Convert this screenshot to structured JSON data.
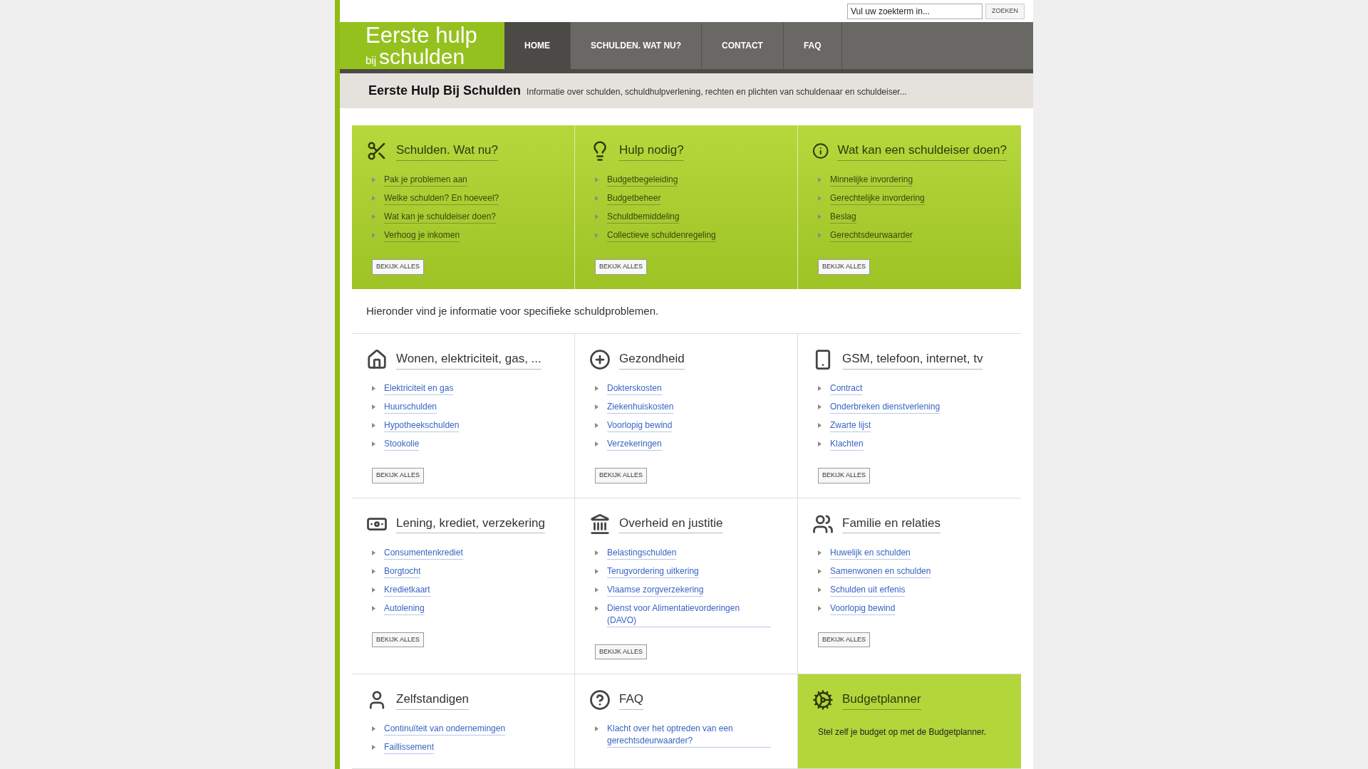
{
  "search": {
    "placeholder": "Vul uw zoekterm in...",
    "button": "ZOEKEN"
  },
  "logo": {
    "line1": "Eerste hulp",
    "small": "bij",
    "line2": "schulden"
  },
  "nav": [
    {
      "label": "HOME",
      "selected": true
    },
    {
      "label": "SCHULDEN. WAT NU?",
      "selected": false
    },
    {
      "label": "CONTACT",
      "selected": false
    },
    {
      "label": "FAQ",
      "selected": false
    }
  ],
  "tagline": {
    "title": "Eerste Hulp Bij Schulden",
    "text": "Informatie over schulden, schuldhulpverlening, rechten en plichten van schuldenaar en schuldeiser..."
  },
  "featured": [
    {
      "title": "Schulden. Wat nu?",
      "links": [
        "Pak je problemen aan",
        "Welke schulden? En hoeveel?",
        "Wat kan je schuldeiser doen?",
        "Verhoog je inkomen"
      ],
      "button": "BEKIJK ALLES"
    },
    {
      "title": "Hulp nodig?",
      "links": [
        "Budgetbegeleiding",
        "Budgetbeheer",
        "Schuldbemiddeling",
        "Collectieve schuldenregeling"
      ],
      "button": "BEKIJK ALLES"
    },
    {
      "title": "Wat kan een schuldeiser doen?",
      "links": [
        "Minnelijke invordering",
        "Gerechtelijke invordering",
        "Beslag",
        "Gerechtsdeurwaarder"
      ],
      "button": "BEKIJK ALLES"
    }
  ],
  "intro": "Hieronder vind je informatie voor specifieke schuldproblemen.",
  "categories": [
    {
      "kind": "links",
      "title": "Wonen, elektriciteit, gas, ...",
      "links": [
        "Elektriciteit en gas",
        "Huurschulden",
        "Hypotheekschulden",
        "Stookolie"
      ],
      "button": "BEKIJK ALLES"
    },
    {
      "kind": "links",
      "title": "Gezondheid",
      "links": [
        "Dokterskosten",
        "Ziekenhuiskosten",
        "Voorlopig bewind",
        "Verzekeringen"
      ],
      "button": "BEKIJK ALLES"
    },
    {
      "kind": "links",
      "title": "GSM, telefoon, internet, tv",
      "links": [
        "Contract",
        "Onderbreken dienstverlening",
        "Zwarte lijst",
        "Klachten"
      ],
      "button": "BEKIJK ALLES"
    },
    {
      "kind": "links",
      "title": "Lening, krediet, verzekering",
      "links": [
        "Consumentenkrediet",
        "Borgtocht",
        "Kredietkaart",
        "Autolening"
      ],
      "button": "BEKIJK ALLES"
    },
    {
      "kind": "links",
      "title": "Overheid en justitie",
      "links": [
        "Belastingschulden",
        "Terugvordering uitkering",
        "Vlaamse zorgverzekering",
        "Dienst voor Alimentatievorderingen (DAVO)"
      ],
      "button": "BEKIJK ALLES"
    },
    {
      "kind": "links",
      "title": "Familie en relaties",
      "links": [
        "Huwelijk en schulden",
        "Samenwonen en schulden",
        "Schulden uit erfenis",
        "Voorlopig bewind"
      ],
      "button": "BEKIJK ALLES"
    },
    {
      "kind": "links",
      "title": "Zelfstandigen",
      "links": [
        "Continuïteit van ondernemingen",
        "Faillissement"
      ]
    },
    {
      "kind": "links",
      "title": "FAQ",
      "links": [
        "Klacht over het optreden van een gerechtsdeurwaarder?"
      ]
    },
    {
      "kind": "promo",
      "title": "Budgetplanner",
      "text": "Stel zelf je budget op met de Budgetplanner."
    }
  ]
}
